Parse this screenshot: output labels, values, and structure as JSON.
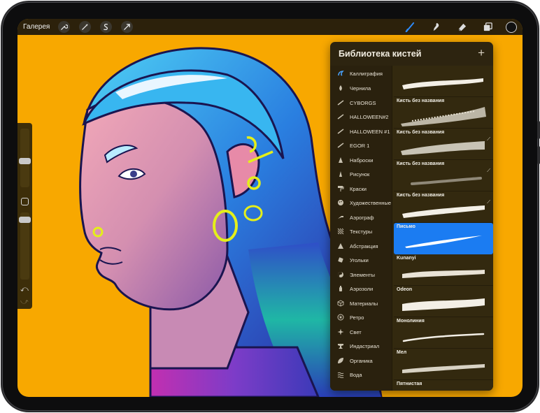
{
  "app": {
    "gallery_label": "Галерея",
    "left_tools": [
      "wrench-icon",
      "magic-wand-icon",
      "selection-icon",
      "transform-icon"
    ],
    "right_tools": [
      "brush-icon",
      "smudge-icon",
      "eraser-icon",
      "layers-icon"
    ],
    "active_tool": "brush-icon",
    "current_color": "#111111",
    "accent": "#1b7cf2"
  },
  "sidebar": {
    "undo_symbol": "⤺",
    "redo_symbol": "⤻"
  },
  "brush_library": {
    "title": "Библиотека кистей",
    "add_symbol": "+",
    "categories": [
      {
        "label": "Каллиграфия",
        "icon": "calligraphy-icon",
        "selected": true
      },
      {
        "label": "Чернила",
        "icon": "ink-drop-icon"
      },
      {
        "label": "CYBORGS",
        "icon": "stroke-icon"
      },
      {
        "label": "HALLOWEEN#2",
        "icon": "stroke-icon"
      },
      {
        "label": "HALLOWEEN #1",
        "icon": "stroke-icon"
      },
      {
        "label": "EGOR 1",
        "icon": "stroke-icon"
      },
      {
        "label": "Наброски",
        "icon": "pencil-tip-icon"
      },
      {
        "label": "Рисунок",
        "icon": "drawing-icon"
      },
      {
        "label": "Краски",
        "icon": "paint-roller-icon"
      },
      {
        "label": "Художественные",
        "icon": "palette-icon"
      },
      {
        "label": "Аэрограф",
        "icon": "airbrush-icon"
      },
      {
        "label": "Текстуры",
        "icon": "texture-icon"
      },
      {
        "label": "Абстракция",
        "icon": "triangle-icon"
      },
      {
        "label": "Угольки",
        "icon": "charcoal-icon"
      },
      {
        "label": "Элементы",
        "icon": "yin-yang-icon"
      },
      {
        "label": "Аэрозоли",
        "icon": "spray-can-icon"
      },
      {
        "label": "Материалы",
        "icon": "cube-icon"
      },
      {
        "label": "Ретро",
        "icon": "star-badge-icon"
      },
      {
        "label": "Свет",
        "icon": "sparkle-icon"
      },
      {
        "label": "Индастриал",
        "icon": "anvil-icon"
      },
      {
        "label": "Органика",
        "icon": "leaf-icon"
      },
      {
        "label": "Вода",
        "icon": "waves-icon"
      }
    ],
    "brushes": [
      {
        "name": "",
        "selected": false
      },
      {
        "name": "Кисть без названия",
        "selected": false
      },
      {
        "name": "Кисть без названия",
        "selected": false
      },
      {
        "name": "Кисть без названия",
        "selected": false
      },
      {
        "name": "Кисть без названия",
        "selected": false
      },
      {
        "name": "Письмо",
        "selected": true
      },
      {
        "name": "Kunanyi",
        "selected": false
      },
      {
        "name": "Odeon",
        "selected": false
      },
      {
        "name": "Монолиния",
        "selected": false
      },
      {
        "name": "Мел",
        "selected": false
      },
      {
        "name": "Пятнистая",
        "selected": false
      }
    ]
  }
}
